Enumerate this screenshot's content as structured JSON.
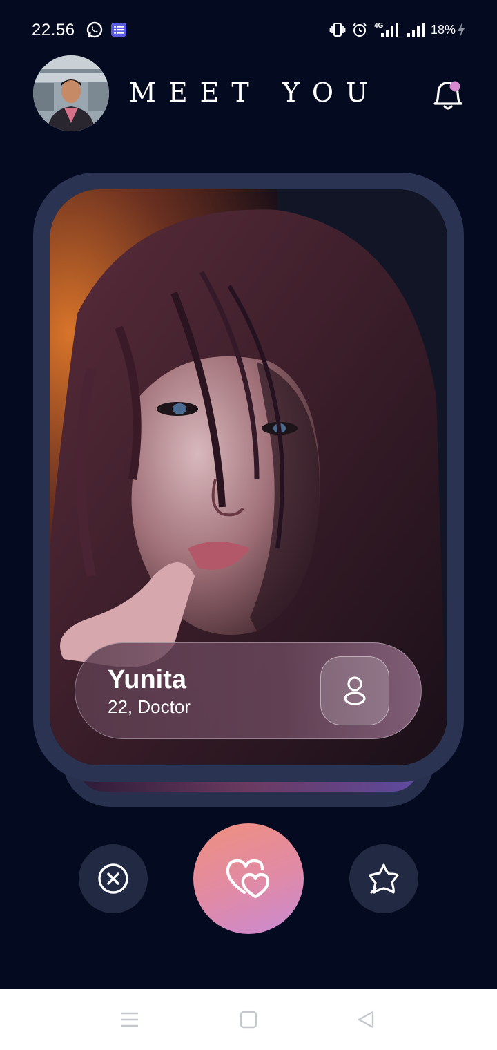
{
  "status_bar": {
    "time": "22.56",
    "network": "4G",
    "battery": "18%",
    "icons": [
      "whatsapp-icon",
      "notes-icon",
      "vibrate-icon",
      "alarm-icon",
      "signal-4g-icon",
      "signal-icon",
      "charging-icon"
    ]
  },
  "header": {
    "title": "MEET YOU",
    "avatar": "user-avatar",
    "notification_icon": "bell-icon",
    "notification_dot_color": "#d78ad0"
  },
  "profile": {
    "name": "Yunita",
    "meta": "22, Doctor",
    "detail_icon": "person-icon"
  },
  "actions": {
    "dislike_icon": "close-circle-icon",
    "like_icon": "hearts-icon",
    "superlike_icon": "star-icon",
    "like_gradient": [
      "#f0907e",
      "#c98ad4"
    ]
  },
  "nav": {
    "icons": [
      "menu-icon",
      "home-icon",
      "back-icon"
    ]
  },
  "colors": {
    "background": "#040a1f",
    "card_frame": "#2a3352",
    "button_dark": "#222a43"
  }
}
